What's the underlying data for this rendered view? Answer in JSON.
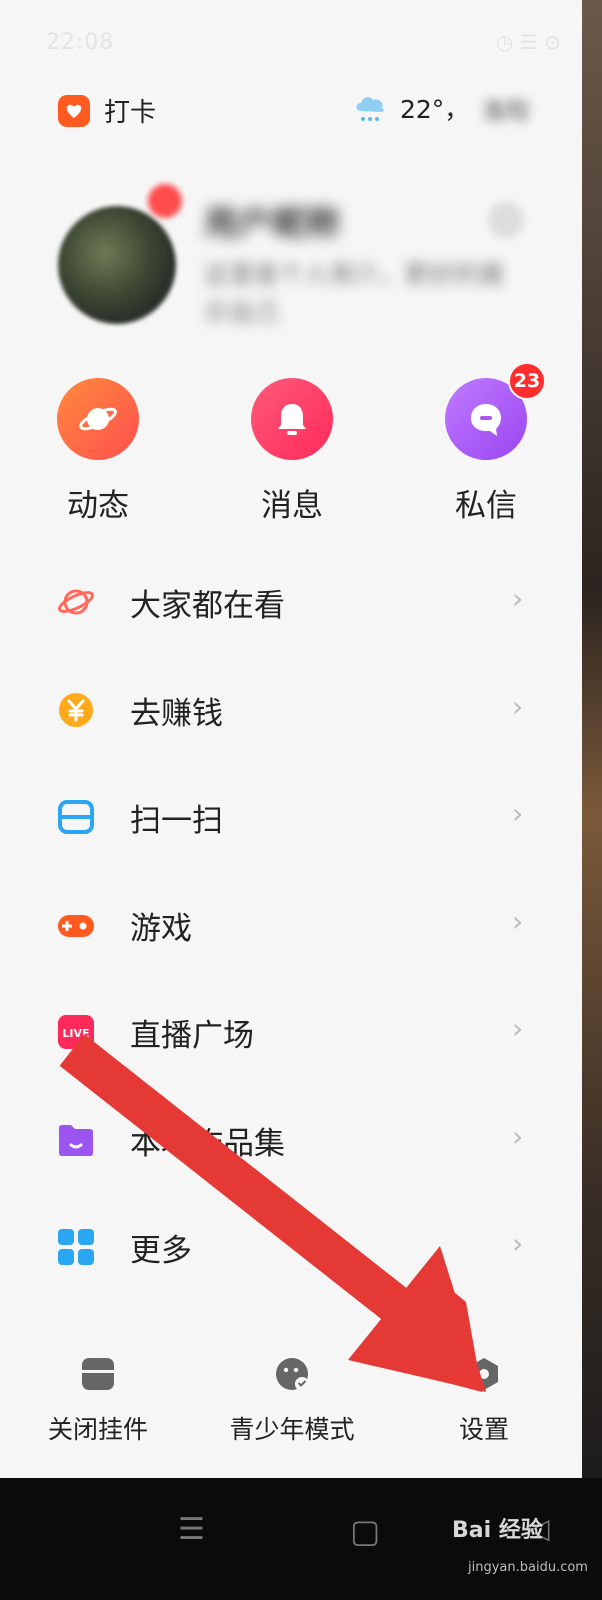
{
  "status_bar": {
    "time": "22:08",
    "icons": "◷ ☰ ⊙"
  },
  "header": {
    "checkin_label": "打卡",
    "weather_label": "22°，",
    "weather_city": "洛阳"
  },
  "profile": {
    "username": "用户昵称",
    "bio": "这里是个人简介，更好的展示自己",
    "avatar_blurred": true
  },
  "quick_actions": [
    {
      "label": "动态",
      "icon": "planet-icon",
      "color": "#ff6a4a"
    },
    {
      "label": "消息",
      "icon": "bell-icon",
      "color": "#ff3b6a"
    },
    {
      "label": "私信",
      "icon": "chat-icon",
      "color": "#a955f0",
      "badge": "23"
    }
  ],
  "menu": {
    "items": [
      {
        "label": "大家都在看",
        "icon": "planet-outline-icon"
      },
      {
        "label": "去赚钱",
        "icon": "yuan-coin-icon"
      },
      {
        "label": "扫一扫",
        "icon": "scan-icon"
      },
      {
        "label": "游戏",
        "icon": "gamepad-icon"
      },
      {
        "label": "直播广场",
        "icon": "live-icon",
        "icon_text": "LIVE"
      },
      {
        "label": "本地作品集",
        "icon": "folder-icon"
      },
      {
        "label": "更多",
        "icon": "grid-icon"
      }
    ],
    "chevron": "›"
  },
  "bottom_bar": [
    {
      "label": "关闭挂件",
      "icon": "widget-icon"
    },
    {
      "label": "青少年模式",
      "icon": "youth-mode-icon"
    },
    {
      "label": "设置",
      "icon": "settings-hex-icon"
    }
  ],
  "nav_bar": {
    "menu_icon": "☰",
    "home_icon": "▢",
    "back_icon": "◁"
  },
  "watermark": {
    "brand": "Bai 经验",
    "url": "jingyan.baidu.com"
  },
  "colors": {
    "arrow": "#e53935",
    "accent": "#ff5a1f"
  }
}
